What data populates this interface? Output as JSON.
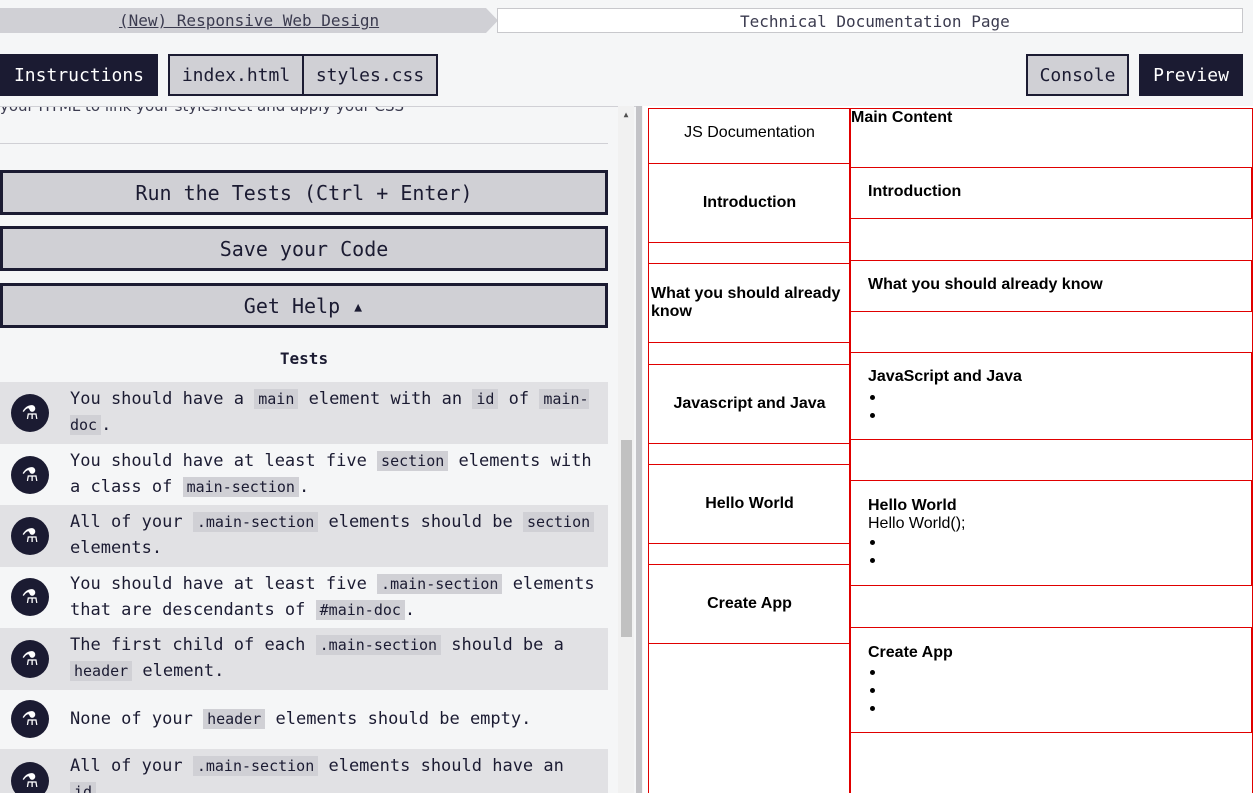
{
  "breadcrumb": {
    "course": "(New) Responsive Web Design",
    "project": "Technical Documentation Page"
  },
  "tabs": {
    "instructions": "Instructions",
    "index": "index.html",
    "styles": "styles.css",
    "console": "Console",
    "preview": "Preview"
  },
  "instructions_tail": "your HTML to link your stylesheet and apply your CSS",
  "buttons": {
    "run": "Run the Tests (Ctrl + Enter)",
    "save": "Save your Code",
    "help": "Get Help ▴"
  },
  "tests_title": "Tests",
  "tests": [
    {
      "parts": [
        "You should have a ",
        "main",
        " element with an ",
        "id",
        " of ",
        "main-doc",
        "."
      ]
    },
    {
      "parts": [
        "You should have at least five ",
        "section",
        " elements with a class of ",
        "main-section",
        "."
      ]
    },
    {
      "parts": [
        "All of your ",
        ".main-section",
        " elements should be ",
        "section",
        " elements."
      ]
    },
    {
      "parts": [
        "You should have at least five ",
        ".main-section",
        " elements that are descendants of ",
        "#main-doc",
        "."
      ]
    },
    {
      "parts": [
        "The first child of each ",
        ".main-section",
        " should be a ",
        "header",
        " element."
      ]
    },
    {
      "parts": [
        "None of your ",
        "header",
        " elements should be empty."
      ]
    },
    {
      "parts": [
        "All of your ",
        ".main-section",
        " elements should have an ",
        "id",
        ""
      ]
    }
  ],
  "preview": {
    "nav_title": "JS Documentation",
    "nav_links": [
      "Introduction",
      "What you should already know",
      "Javascript and Java",
      "Hello World",
      "Create App"
    ],
    "main_title": "Main Content",
    "sections": [
      {
        "title": "Introduction",
        "lines": []
      },
      {
        "title": "What you should already know",
        "lines": []
      },
      {
        "title": "JavaScript and Java",
        "lines": []
      },
      {
        "title": "Hello World",
        "lines": [
          "Hello World();"
        ]
      },
      {
        "title": "Create App",
        "lines": []
      }
    ]
  },
  "colors": {
    "dark": "#1b1b32",
    "button_gray": "#d0d0d5",
    "preview_border": "#e00000"
  }
}
